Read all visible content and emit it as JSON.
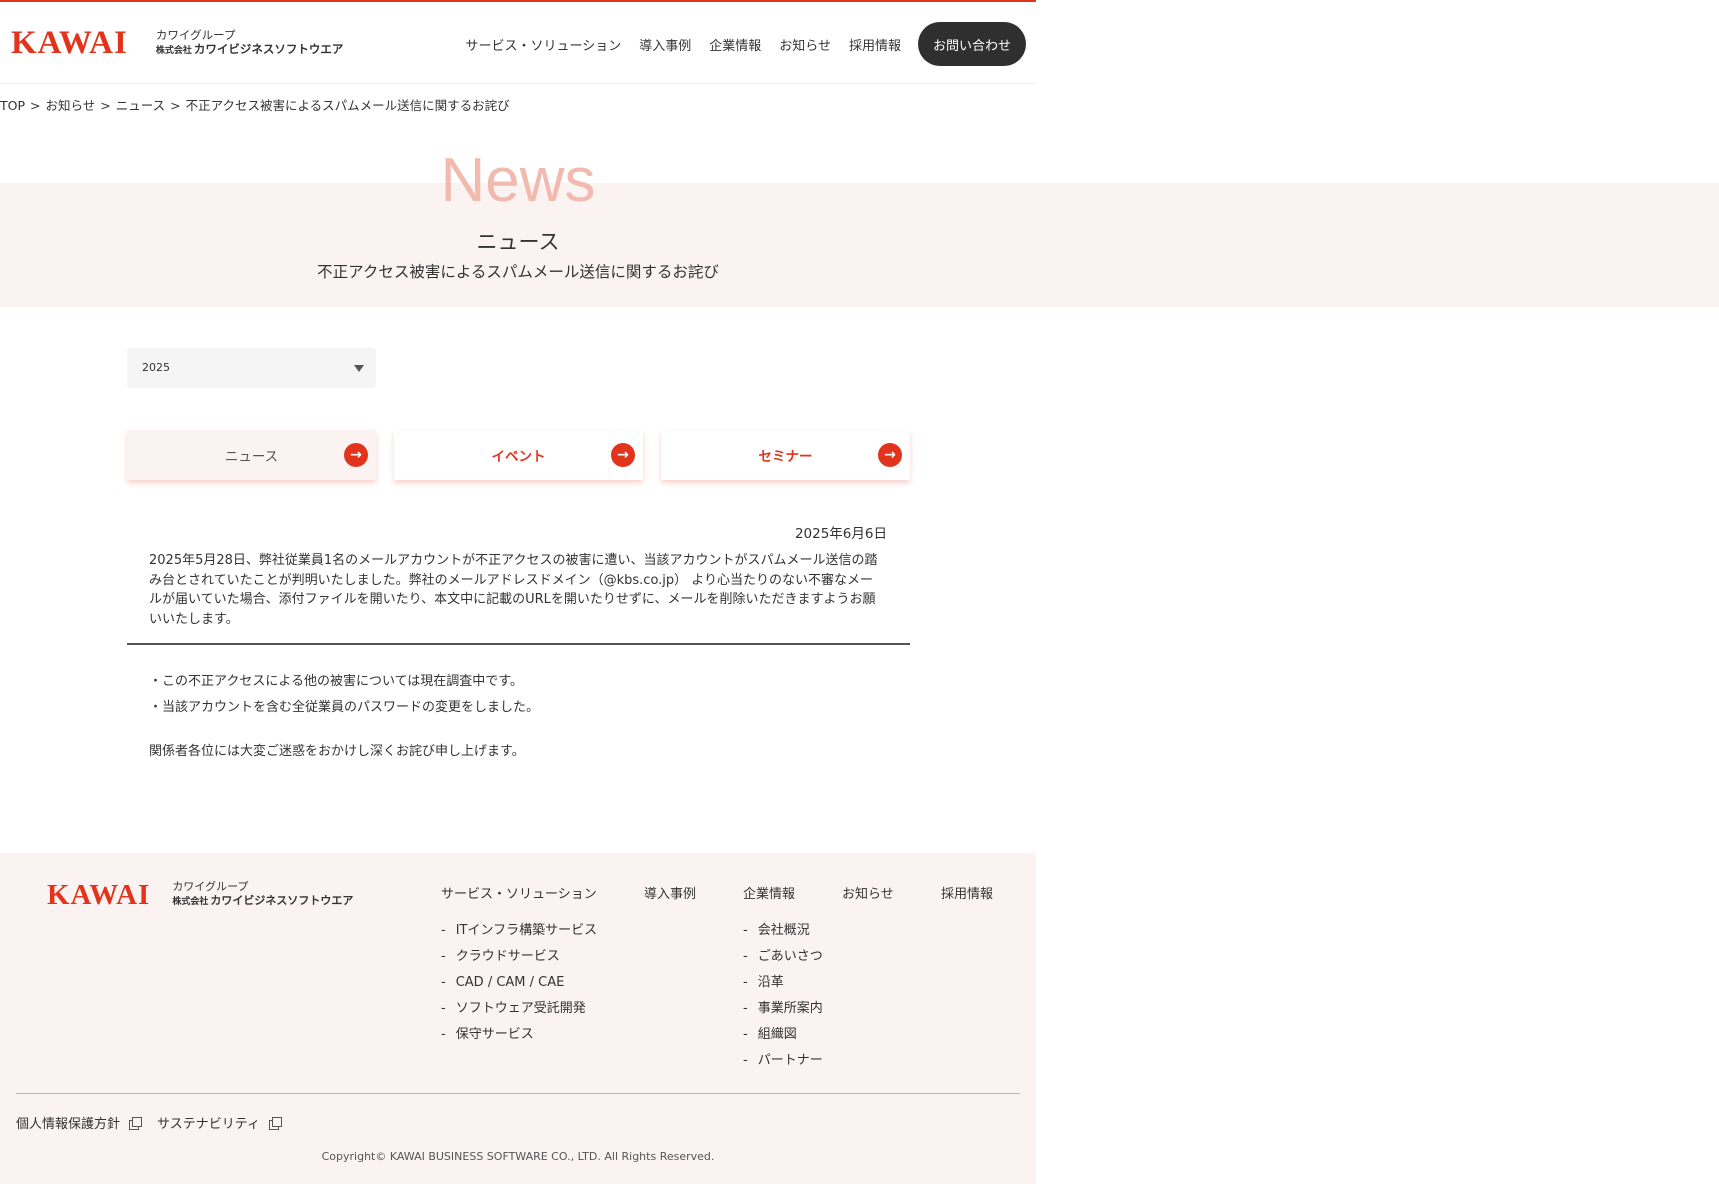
{
  "header": {
    "logo_word": "KAWAI",
    "logo_line1": "カワイグループ",
    "logo_line2_prefix": "株式会社",
    "logo_line2": "カワイビジネスソフトウエア",
    "nav": [
      "サービス・ソリューション",
      "導入事例",
      "企業情報",
      "お知らせ",
      "採用情報"
    ],
    "contact_label": "お問い合わせ"
  },
  "breadcrumb": {
    "items": [
      "TOP",
      "お知らせ",
      "ニュース",
      "不正アクセス被害によるスパムメール送信に関するお詫び"
    ],
    "separator": ">"
  },
  "hero": {
    "en": "News",
    "ja": "ニュース",
    "title": "不正アクセス被害によるスパムメール送信に関するお詫び"
  },
  "year_select": {
    "value": "2025"
  },
  "category_tabs": [
    {
      "label": "ニュース",
      "active": true
    },
    {
      "label": "イベント",
      "active": false
    },
    {
      "label": "セミナー",
      "active": false
    }
  ],
  "arrow_glyph": "→",
  "post": {
    "date": "2025年6月6日",
    "body": "2025年5月28日、弊社従業員1名のメールアカウントが不正アクセスの被害に遭い、当該アカウントがスパムメール送信の踏み台とされていたことが判明いたしました。弊社のメールアドレスドメイン（@kbs.co.jp） より心当たりのない不審なメールが届いていた場合、添付ファイルを開いたり、本文中に記載のURLを開いたりせずに、メールを削除いただきますようお願いいたします。",
    "notes": [
      "・この不正アクセスによる他の被害については現在調査中です。",
      "・当該アカウントを含む全従業員のパスワードの変更をしました。"
    ],
    "closing": "関係者各位には大変ご迷惑をおかけし深くお詫び申し上げます。"
  },
  "footer": {
    "logo_word": "KAWAI",
    "logo_line1": "カワイグループ",
    "logo_line2_prefix": "株式会社",
    "logo_line2": "カワイビジネスソフトウエア",
    "columns": [
      {
        "heading": "サービス・ソリューション",
        "items": [
          "ITインフラ構築サービス",
          "クラウドサービス",
          "CAD / CAM / CAE",
          "ソフトウェア受託開発",
          "保守サービス"
        ]
      },
      {
        "heading": "導入事例",
        "items": []
      },
      {
        "heading": "企業情報",
        "items": [
          "会社概況",
          "ごあいさつ",
          "沿革",
          "事業所案内",
          "組織図",
          "パートナー"
        ]
      },
      {
        "heading": "お知らせ",
        "items": []
      },
      {
        "heading": "採用情報",
        "items": []
      }
    ],
    "bottom_links": [
      "個人情報保護方針",
      "サステナビリティ"
    ],
    "copyright": "Copyright© KAWAI BUSINESS SOFTWARE CO., LTD. All Rights Reserved."
  },
  "colors": {
    "brand_red": "#e2341d",
    "hero_bg": "#faf3f1",
    "hero_en_text": "#f2b9ae",
    "contact_button_bg": "#2f2f2f"
  },
  "icons": [
    "arrow-right-icon",
    "dropdown-triangle-icon",
    "external-link-icon"
  ]
}
